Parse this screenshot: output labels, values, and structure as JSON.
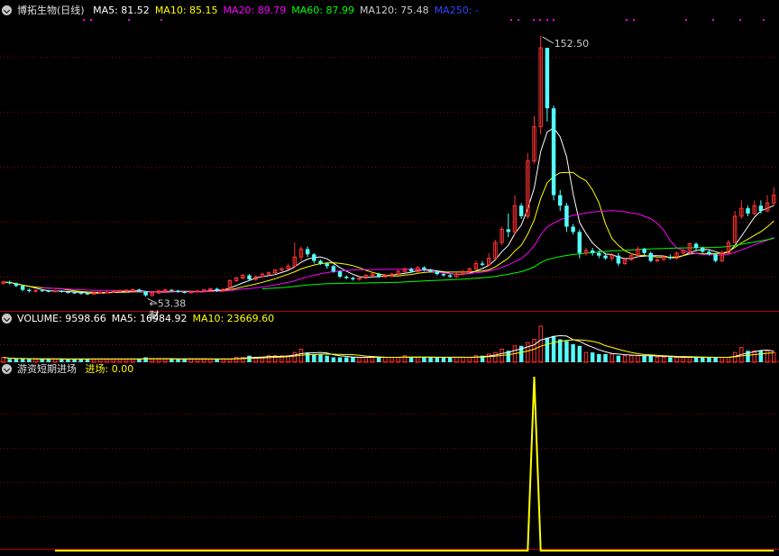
{
  "main_legend": {
    "stock_name": "博拓生物(日线)",
    "items": [
      {
        "label": "MA5: 81.52",
        "color": "#ffffff"
      },
      {
        "label": "MA10: 85.15",
        "color": "#ffff00"
      },
      {
        "label": "MA20: 89.79",
        "color": "#ff00ff"
      },
      {
        "label": "MA60: 87.99",
        "color": "#00ff00"
      },
      {
        "label": "MA120: 75.48",
        "color": "#cccccc"
      },
      {
        "label": "MA250: -",
        "color": "#3344ff"
      }
    ]
  },
  "volume_legend": {
    "items": [
      {
        "label": "VOLUME: 9598.66",
        "color": "#ffffff"
      },
      {
        "label": "MA5: 16984.92",
        "color": "#ffffff"
      },
      {
        "label": "MA10: 23669.60",
        "color": "#ffff00"
      }
    ]
  },
  "indicator_legend": {
    "name": "游资短期进场",
    "items": [
      {
        "label": "进场: 0.00",
        "color": "#ffff00"
      }
    ]
  },
  "annotations": {
    "high_label": "152.50",
    "low_label": "53.38",
    "event_marker": "财"
  },
  "colors": {
    "up": "#ff3232",
    "down": "#54ffff",
    "grid": "#8b0000",
    "divider": "#b00000"
  },
  "chart_data": [
    {
      "type": "candlestick",
      "ylim": [
        48,
        160
      ],
      "high": 152.5,
      "low": 53.38,
      "candles": [
        [
          58.5,
          59.0,
          59.5,
          58.0
        ],
        [
          59.0,
          58.5,
          59.5,
          58.0
        ],
        [
          58.5,
          57.5,
          58.8,
          57.0
        ],
        [
          57.5,
          56.0,
          57.8,
          55.5
        ],
        [
          56.0,
          55.5,
          56.5,
          55.0
        ],
        [
          55.5,
          55.8,
          56.2,
          55.0
        ],
        [
          55.8,
          55.6,
          56.2,
          55.2
        ],
        [
          55.6,
          55.4,
          56.0,
          55.0
        ],
        [
          55.4,
          55.6,
          56.0,
          55.0
        ],
        [
          55.6,
          55.2,
          55.9,
          54.9
        ],
        [
          55.2,
          55.0,
          55.6,
          54.6
        ],
        [
          55.0,
          54.8,
          55.4,
          54.4
        ],
        [
          54.8,
          54.6,
          55.2,
          54.2
        ],
        [
          54.6,
          54.4,
          55.0,
          54.0
        ],
        [
          54.4,
          54.9,
          55.3,
          54.2
        ],
        [
          54.9,
          55.1,
          55.5,
          54.6
        ],
        [
          55.1,
          55.2,
          55.6,
          54.8
        ],
        [
          55.2,
          55.5,
          55.9,
          54.9
        ],
        [
          55.5,
          55.7,
          56.1,
          55.2
        ],
        [
          55.7,
          55.9,
          56.3,
          55.4
        ],
        [
          55.9,
          56.1,
          56.5,
          55.6
        ],
        [
          56.1,
          55.4,
          56.4,
          55.0
        ],
        [
          55.4,
          53.9,
          55.6,
          53.38
        ],
        [
          53.9,
          54.8,
          55.2,
          53.5
        ],
        [
          54.8,
          55.6,
          56.0,
          54.5
        ],
        [
          55.6,
          56.0,
          56.4,
          55.3
        ],
        [
          56.0,
          55.7,
          56.3,
          55.3
        ],
        [
          55.7,
          55.2,
          56.0,
          54.9
        ],
        [
          55.2,
          54.9,
          55.5,
          54.6
        ],
        [
          54.9,
          55.3,
          55.7,
          54.6
        ],
        [
          55.3,
          55.6,
          56.0,
          55.0
        ],
        [
          55.6,
          56.0,
          56.3,
          55.3
        ],
        [
          56.0,
          56.4,
          56.8,
          55.7
        ],
        [
          56.4,
          55.6,
          56.8,
          55.2
        ],
        [
          55.6,
          56.2,
          56.6,
          55.3
        ],
        [
          56.2,
          59.5,
          60.0,
          56.0
        ],
        [
          59.5,
          60.5,
          61.0,
          59.0
        ],
        [
          60.5,
          61.5,
          62.0,
          60.0
        ],
        [
          61.5,
          60.0,
          62.0,
          59.5
        ],
        [
          60.0,
          61.0,
          61.5,
          59.5
        ],
        [
          61.0,
          62.0,
          62.5,
          60.5
        ],
        [
          62.0,
          62.5,
          63.0,
          61.5
        ],
        [
          62.5,
          63.5,
          64.0,
          62.0
        ],
        [
          63.5,
          64.0,
          64.5,
          63.0
        ],
        [
          64.0,
          65.0,
          66.0,
          63.5
        ],
        [
          65.0,
          68.5,
          74.0,
          64.5
        ],
        [
          68.5,
          71.5,
          72.5,
          67.0
        ],
        [
          71.5,
          69.5,
          72.5,
          68.5
        ],
        [
          69.5,
          67.0,
          70.0,
          66.0
        ],
        [
          67.0,
          66.0,
          67.5,
          65.5
        ],
        [
          66.0,
          65.0,
          66.5,
          64.0
        ],
        [
          65.0,
          63.0,
          65.5,
          62.5
        ],
        [
          63.0,
          61.0,
          63.5,
          60.5
        ],
        [
          61.0,
          60.5,
          61.5,
          60.0
        ],
        [
          60.5,
          60.0,
          61.0,
          59.5
        ],
        [
          60.0,
          60.5,
          61.0,
          59.5
        ],
        [
          60.5,
          61.5,
          62.0,
          60.0
        ],
        [
          61.5,
          62.0,
          62.5,
          61.0
        ],
        [
          62.0,
          61.0,
          62.5,
          60.5
        ],
        [
          61.0,
          61.5,
          62.0,
          60.5
        ],
        [
          61.5,
          62.0,
          62.5,
          61.0
        ],
        [
          62.0,
          63.0,
          63.5,
          61.5
        ],
        [
          63.0,
          64.0,
          64.5,
          62.5
        ],
        [
          64.0,
          63.0,
          64.5,
          62.5
        ],
        [
          63.0,
          64.5,
          65.0,
          62.5
        ],
        [
          64.5,
          63.5,
          65.0,
          63.0
        ],
        [
          63.5,
          63.0,
          64.0,
          62.5
        ],
        [
          63.0,
          62.0,
          63.5,
          61.5
        ],
        [
          62.0,
          61.5,
          62.5,
          61.0
        ],
        [
          61.5,
          61.0,
          62.0,
          60.5
        ],
        [
          61.0,
          62.0,
          62.5,
          60.5
        ],
        [
          62.0,
          63.0,
          63.5,
          61.5
        ],
        [
          63.0,
          64.0,
          64.5,
          62.5
        ],
        [
          64.0,
          66.0,
          67.0,
          63.5
        ],
        [
          66.0,
          65.5,
          67.0,
          65.0
        ],
        [
          65.5,
          68.0,
          70.0,
          65.0
        ],
        [
          68.0,
          74.0,
          75.0,
          67.5
        ],
        [
          74.0,
          79.0,
          80.0,
          73.0
        ],
        [
          79.0,
          78.0,
          85.0,
          76.0
        ],
        [
          78.0,
          88.0,
          92.0,
          77.0
        ],
        [
          88.0,
          84.0,
          89.0,
          83.0
        ],
        [
          84.0,
          105.0,
          108.0,
          83.0
        ],
        [
          105.0,
          118.0,
          122.0,
          104.0
        ],
        [
          118.0,
          148.0,
          152.5,
          115.0
        ],
        [
          148.0,
          125.0,
          140.0,
          120.0
        ],
        [
          125.0,
          92.0,
          126.0,
          90.0
        ],
        [
          92.0,
          88.0,
          94.0,
          86.0
        ],
        [
          88.0,
          80.0,
          89.0,
          78.0
        ],
        [
          80.0,
          78.0,
          81.0,
          77.0
        ],
        [
          78.0,
          70.0,
          79.0,
          68.0
        ],
        [
          70.0,
          71.0,
          72.0,
          69.0
        ],
        [
          71.0,
          70.0,
          72.0,
          69.0
        ],
        [
          70.0,
          69.0,
          71.0,
          68.0
        ],
        [
          69.0,
          68.0,
          70.0,
          67.5
        ],
        [
          68.0,
          69.0,
          70.0,
          67.0
        ],
        [
          69.0,
          66.0,
          70.0,
          65.0
        ],
        [
          66.0,
          67.5,
          68.0,
          65.5
        ],
        [
          67.5,
          69.0,
          70.0,
          67.0
        ],
        [
          69.0,
          71.5,
          72.5,
          68.5
        ],
        [
          71.5,
          70.0,
          72.0,
          69.0
        ],
        [
          70.0,
          67.0,
          70.5,
          66.5
        ],
        [
          67.0,
          67.5,
          68.0,
          66.5
        ],
        [
          67.5,
          68.5,
          69.0,
          67.0
        ],
        [
          68.5,
          68.0,
          69.5,
          67.5
        ],
        [
          68.0,
          70.0,
          70.5,
          67.5
        ],
        [
          70.0,
          71.0,
          71.5,
          69.5
        ],
        [
          71.0,
          73.5,
          74.0,
          70.5
        ],
        [
          73.5,
          72.0,
          74.0,
          71.0
        ],
        [
          72.0,
          70.5,
          72.5,
          70.0
        ],
        [
          70.5,
          69.5,
          71.0,
          69.0
        ],
        [
          69.5,
          67.0,
          70.0,
          66.5
        ],
        [
          67.0,
          70.0,
          71.0,
          66.5
        ],
        [
          70.0,
          74.0,
          75.0,
          69.5
        ],
        [
          74.0,
          84.0,
          86.0,
          73.5
        ],
        [
          84.0,
          87.0,
          90.0,
          83.0
        ],
        [
          87.0,
          85.0,
          88.0,
          84.0
        ],
        [
          85.0,
          88.0,
          90.0,
          84.5
        ],
        [
          88.0,
          86.0,
          90.0,
          85.0
        ],
        [
          86.0,
          89.0,
          92.0,
          85.5
        ],
        [
          89.0,
          92.0,
          95.0,
          88.0
        ]
      ]
    },
    {
      "type": "bar",
      "series": [
        {
          "name": "VOLUME",
          "values": [
            3,
            2,
            2,
            2,
            2,
            2,
            2,
            2,
            2,
            2,
            2,
            2,
            2,
            2,
            2,
            2,
            2,
            2,
            2,
            2,
            2,
            2,
            3,
            2,
            2,
            2,
            2,
            2,
            2,
            2,
            2,
            2,
            2,
            2,
            2,
            2,
            3,
            3,
            4,
            3,
            3,
            4,
            4,
            4,
            4,
            6,
            8,
            6,
            5,
            5,
            4,
            3,
            3,
            3,
            3,
            3,
            3,
            3,
            3,
            3,
            3,
            3,
            4,
            3,
            3,
            3,
            3,
            3,
            3,
            3,
            3,
            3,
            3,
            4,
            4,
            5,
            6,
            8,
            7,
            10,
            10,
            12,
            14,
            22,
            15,
            16,
            14,
            13,
            11,
            10,
            6,
            6,
            5,
            5,
            5,
            4,
            4,
            4,
            4,
            4,
            4,
            3,
            3,
            3,
            3,
            3,
            3,
            3,
            3,
            3,
            3,
            3,
            3,
            6,
            9,
            7,
            7,
            7,
            7,
            6
          ]
        }
      ],
      "legend": [
        "VOLUME: 9598.66",
        "MA5: 16984.92",
        "MA10: 23669.60"
      ]
    },
    {
      "type": "line",
      "series": [
        {
          "name": "进场",
          "values": [
            0,
            0,
            0,
            0,
            0,
            0,
            0,
            0,
            0,
            0,
            0,
            0,
            0,
            0,
            0,
            0,
            0,
            0,
            0,
            0,
            0,
            0,
            0,
            0,
            0,
            0,
            0,
            0,
            0,
            0,
            0,
            0,
            0,
            0,
            0,
            0,
            0,
            0,
            0,
            0,
            0,
            0,
            0,
            0,
            0,
            0,
            0,
            0,
            0,
            0,
            0,
            0,
            0,
            0,
            0,
            0,
            0,
            0,
            0,
            0,
            0,
            0,
            0,
            0,
            0,
            0,
            0,
            0,
            0,
            0,
            0,
            0,
            0,
            0,
            0,
            0,
            0,
            0,
            0,
            0,
            0,
            0,
            1,
            0,
            0,
            0,
            0,
            0,
            0,
            0,
            0,
            0,
            0,
            0,
            0,
            0,
            0,
            0,
            0,
            0,
            0,
            0,
            0,
            0,
            0,
            0,
            0,
            0,
            0,
            0,
            0,
            0,
            0,
            0,
            0,
            0,
            0,
            0,
            0,
            0
          ]
        }
      ],
      "ylim": [
        0,
        1
      ],
      "legend": [
        "进场: 0.00"
      ]
    }
  ]
}
